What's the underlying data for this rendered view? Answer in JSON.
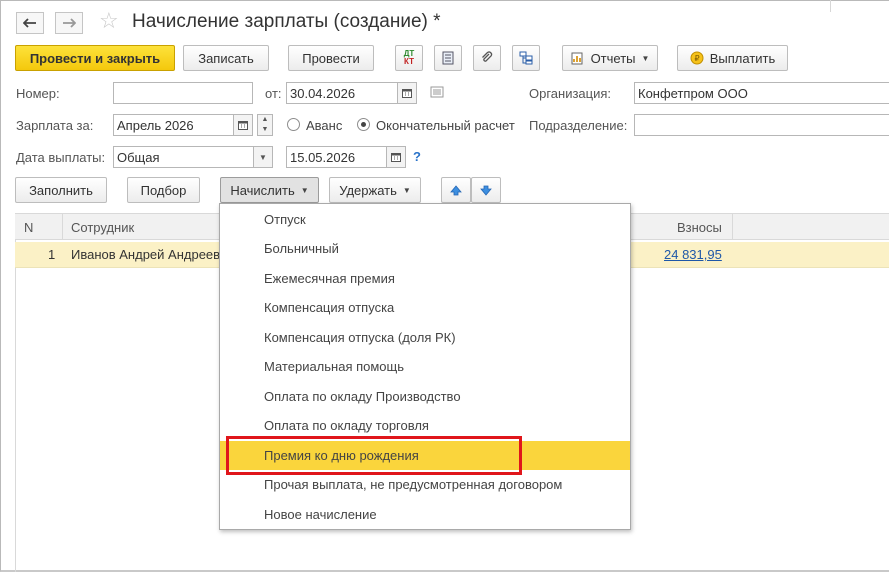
{
  "window": {
    "title": "Начисление зарплаты (создание) *"
  },
  "icons": {
    "back": "arrow-left-icon",
    "forward": "arrow-right-icon",
    "favorite": "star-icon",
    "dtkt": "debit-credit-icon",
    "list": "document-list-icon",
    "attach": "paperclip-icon",
    "structure": "structure-icon",
    "reports": "report-icon",
    "pay": "coin-icon",
    "calendar": "calendar-icon",
    "move_up": "arrow-up-icon",
    "move_down": "arrow-down-icon"
  },
  "toolbar": {
    "post_and_close": "Провести и закрыть",
    "save": "Записать",
    "post": "Провести",
    "dtkt_top": "ДТ",
    "dtkt_bottom": "КТ",
    "reports": "Отчеты",
    "pay": "Выплатить"
  },
  "form": {
    "number_label": "Номер:",
    "number_value": "",
    "date_from_label": "от:",
    "date_value": "30.04.2026",
    "organization_label": "Организация:",
    "organization_value": "Конфетпром ООО",
    "salary_for_label": "Зарплата за:",
    "salary_for_value": "Апрель 2026",
    "advance_label": "Аванс",
    "final_label": "Окончательный расчет",
    "department_label": "Подразделение:",
    "department_value": "",
    "pay_date_label": "Дата выплаты:",
    "pay_date_type": "Общая",
    "pay_date_value": "15.05.2026",
    "help": "?"
  },
  "table_toolbar": {
    "fill": "Заполнить",
    "select": "Подбор",
    "accrue": "Начислить",
    "withhold": "Удержать"
  },
  "table": {
    "columns": [
      "N",
      "Сотрудник",
      "Взносы"
    ],
    "rows": [
      {
        "n": "1",
        "employee": "Иванов Андрей Андреевич",
        "contributions": "24 831,95"
      }
    ]
  },
  "accrue_menu": {
    "items": [
      "Отпуск",
      "Больничный",
      "Ежемесячная премия",
      "Компенсация отпуска",
      "Компенсация отпуска (доля РК)",
      "Материальная помощь",
      "Оплата по окладу Производство",
      "Оплата по окладу торговля",
      "Премия ко дню рождения",
      "Прочая выплата, не предусмотренная договором",
      "Новое начисление"
    ],
    "highlighted_index": 8
  },
  "colors": {
    "primary_button": "#f4c80c",
    "highlight_row": "#fbf1c6",
    "menu_highlight": "#fad53c",
    "annotation_box": "#e0161b",
    "link": "#1f58a8"
  }
}
